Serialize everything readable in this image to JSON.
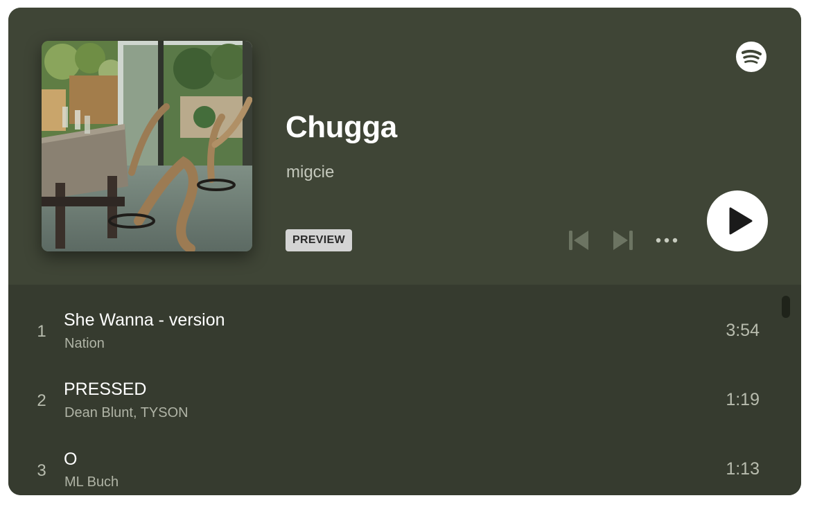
{
  "playlist": {
    "title": "Chugga",
    "owner": "migcie",
    "badge": "PREVIEW"
  },
  "cover": {
    "image": "album-cover-dining-room-chairs"
  },
  "brand": {
    "logo": "spotify-icon",
    "accent": "#3f4536"
  },
  "controls": {
    "previous": "skip-previous-icon",
    "next": "skip-next-icon",
    "more": "more-options-icon",
    "play": "play-icon"
  },
  "tracks": [
    {
      "number": "1",
      "title": "She Wanna - version",
      "artist": "Nation",
      "duration": "3:54"
    },
    {
      "number": "2",
      "title": "PRESSED",
      "artist": "Dean Blunt, TYSON",
      "duration": "1:19"
    },
    {
      "number": "3",
      "title": "O",
      "artist": "ML Buch",
      "duration": "1:13"
    }
  ]
}
